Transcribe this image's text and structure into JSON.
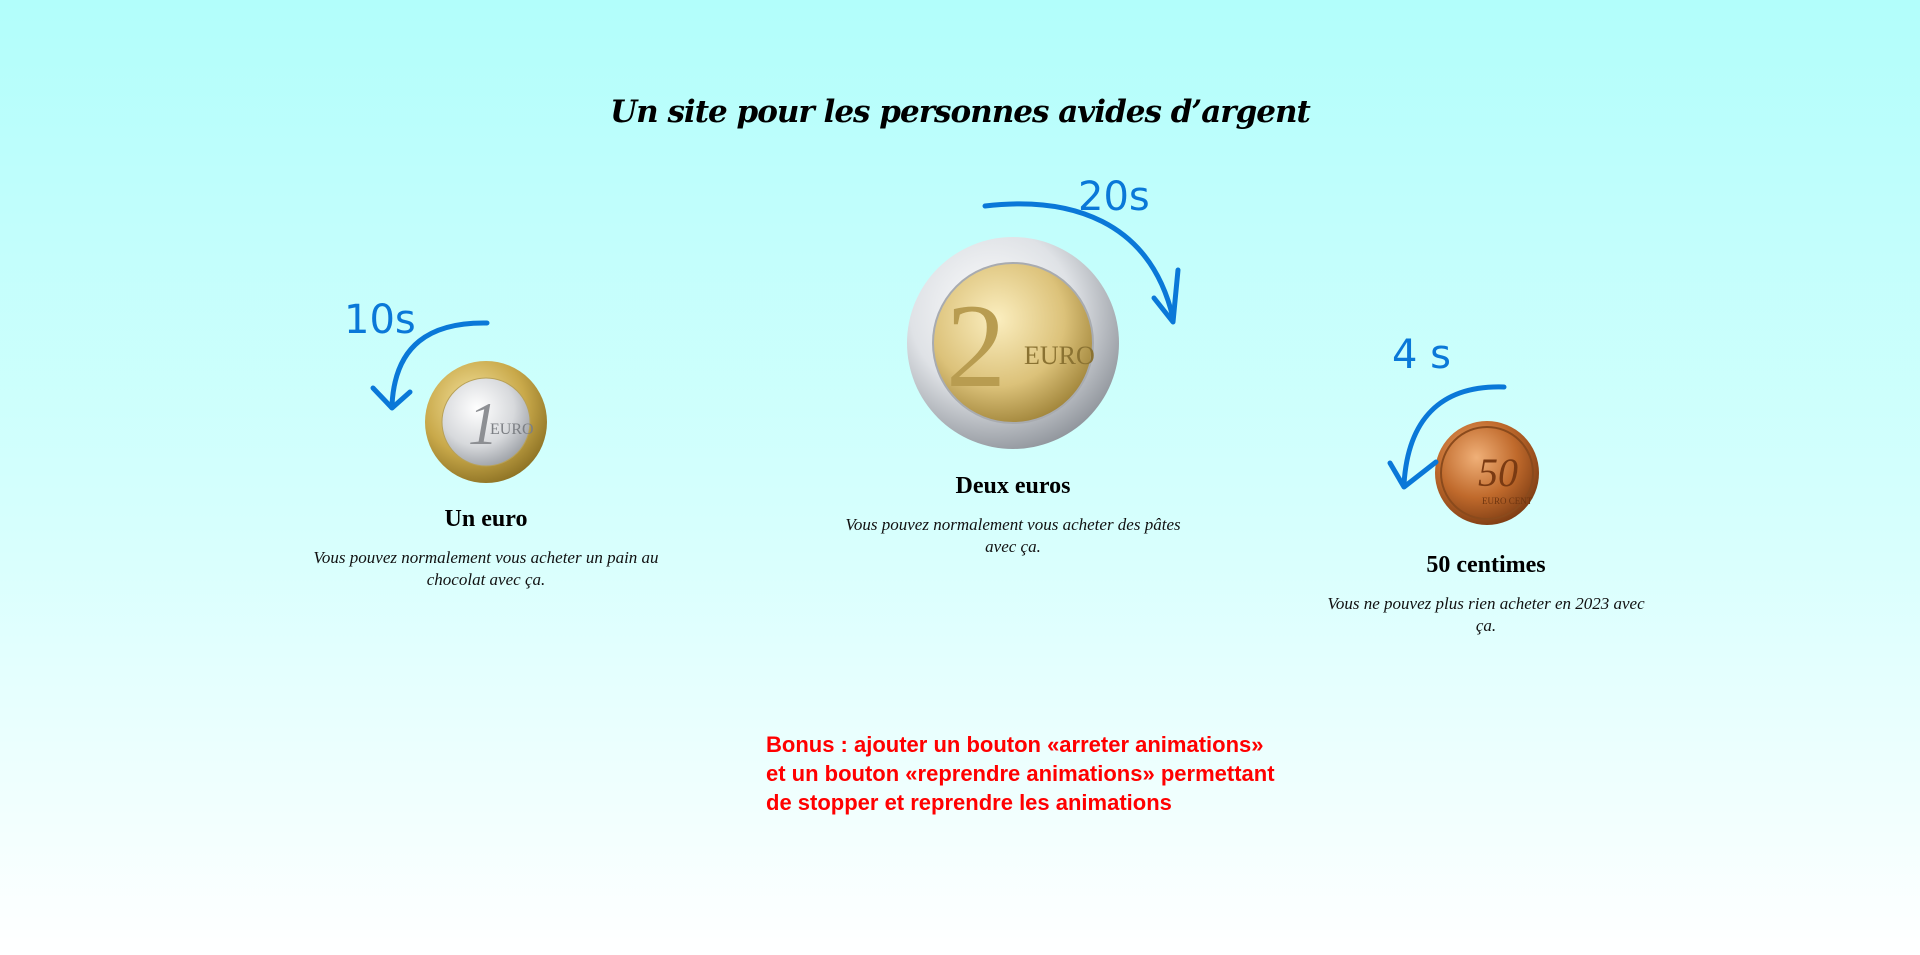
{
  "page": {
    "title": "Un site pour les personnes avides d’argent"
  },
  "cards": [
    {
      "name": "Un euro",
      "description": "Vous pouvez normalement vous acheter un pain au chocolat avec ça.",
      "annotation": "10s",
      "coin_label_digit": "1",
      "coin_label_word": "EURO"
    },
    {
      "name": "Deux euros",
      "description": "Vous pouvez normalement vous acheter des pâtes avec ça.",
      "annotation": "20s",
      "coin_label_digit": "2",
      "coin_label_word": "EURO"
    },
    {
      "name": "50 centimes",
      "description": "Vous ne pouvez plus rien acheter en 2023 avec ça.",
      "annotation": "4 s",
      "coin_label_digit": "50",
      "coin_label_word": "EURO CENT"
    }
  ],
  "bonus": {
    "line1": "Bonus : ajouter un bouton «arreter animations»",
    "line2": "et un bouton «reprendre animations» permettant",
    "line3": "de stopper et reprendre les animations"
  },
  "colors": {
    "annotation_blue": "#0a78d8",
    "bonus_red": "#ff0000",
    "background_top": "#b2fefb",
    "background_bottom": "#ffffff"
  },
  "icons": [
    "one-euro-coin-icon",
    "two-euro-coin-icon",
    "fifty-cent-coin-icon",
    "rotation-arrow-icon"
  ]
}
